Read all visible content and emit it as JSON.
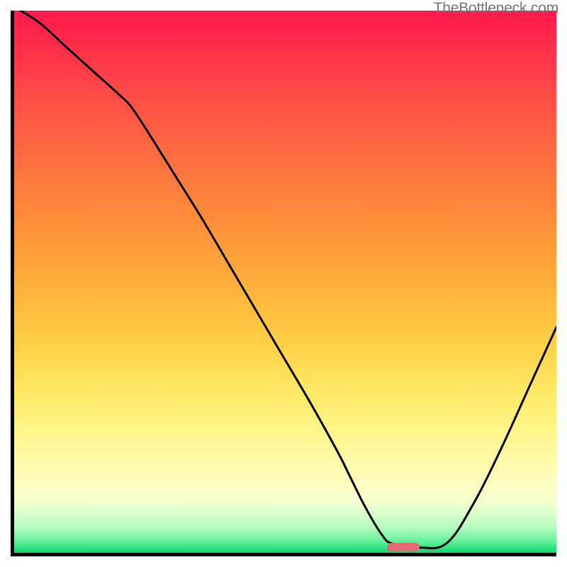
{
  "watermark": "TheBottleneck.com",
  "chart_data": {
    "type": "line",
    "x": [
      0,
      5,
      10,
      15,
      20,
      22,
      25,
      30,
      35,
      40,
      45,
      50,
      55,
      60,
      62,
      65,
      68,
      70,
      75,
      80,
      85,
      90,
      95,
      100
    ],
    "values": [
      101,
      98,
      93.5,
      89,
      84.5,
      82.5,
      78,
      70,
      62,
      53.5,
      45,
      36.5,
      28,
      19,
      15,
      9,
      4,
      2.3,
      1.6,
      2.5,
      10,
      20,
      31,
      42
    ],
    "title": "",
    "xlabel": "",
    "ylabel": "",
    "xlim": [
      0,
      100
    ],
    "ylim": [
      0,
      100
    ],
    "marker": {
      "x_start": 69,
      "x_end": 75,
      "y": 1.7,
      "color": "#e46a6f"
    }
  },
  "colors": {
    "curve": "#000000",
    "marker": "#e46a6f",
    "frame": "#000000"
  }
}
